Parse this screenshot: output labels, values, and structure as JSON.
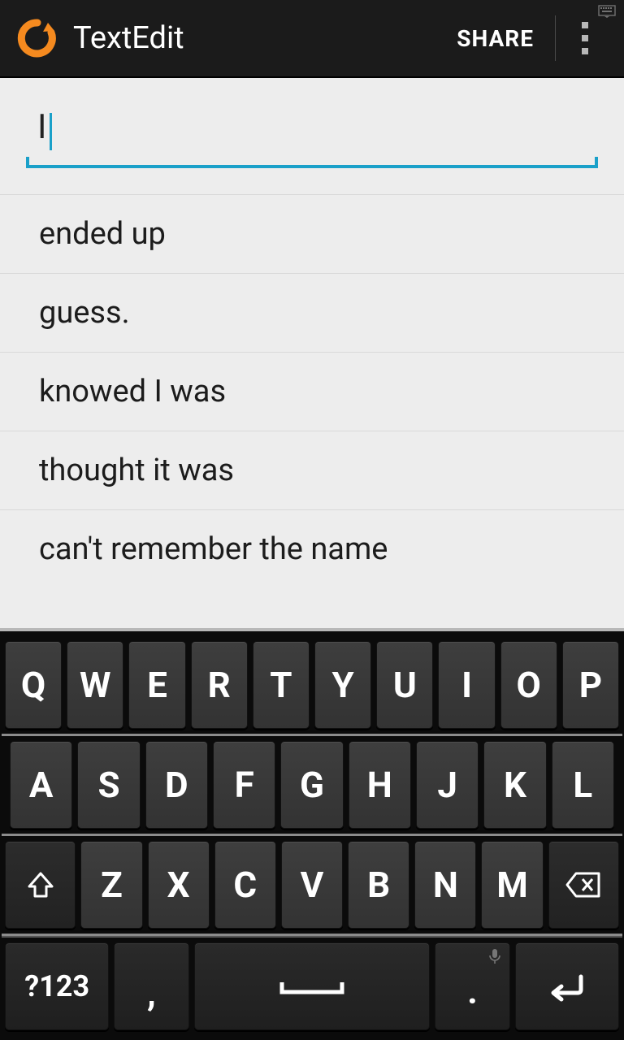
{
  "header": {
    "title": "TextEdit",
    "share_label": "SHARE"
  },
  "input": {
    "value": "I"
  },
  "suggestions": [
    "ended up",
    "guess.",
    "knowed I was",
    "thought it was",
    "can't remember the name"
  ],
  "keyboard": {
    "row1": [
      "Q",
      "W",
      "E",
      "R",
      "T",
      "Y",
      "U",
      "I",
      "O",
      "P"
    ],
    "row2": [
      "A",
      "S",
      "D",
      "F",
      "G",
      "H",
      "J",
      "K",
      "L"
    ],
    "row3": [
      "Z",
      "X",
      "C",
      "V",
      "B",
      "N",
      "M"
    ],
    "sym_label": "?123",
    "comma_label": ",",
    "period_label": "."
  }
}
